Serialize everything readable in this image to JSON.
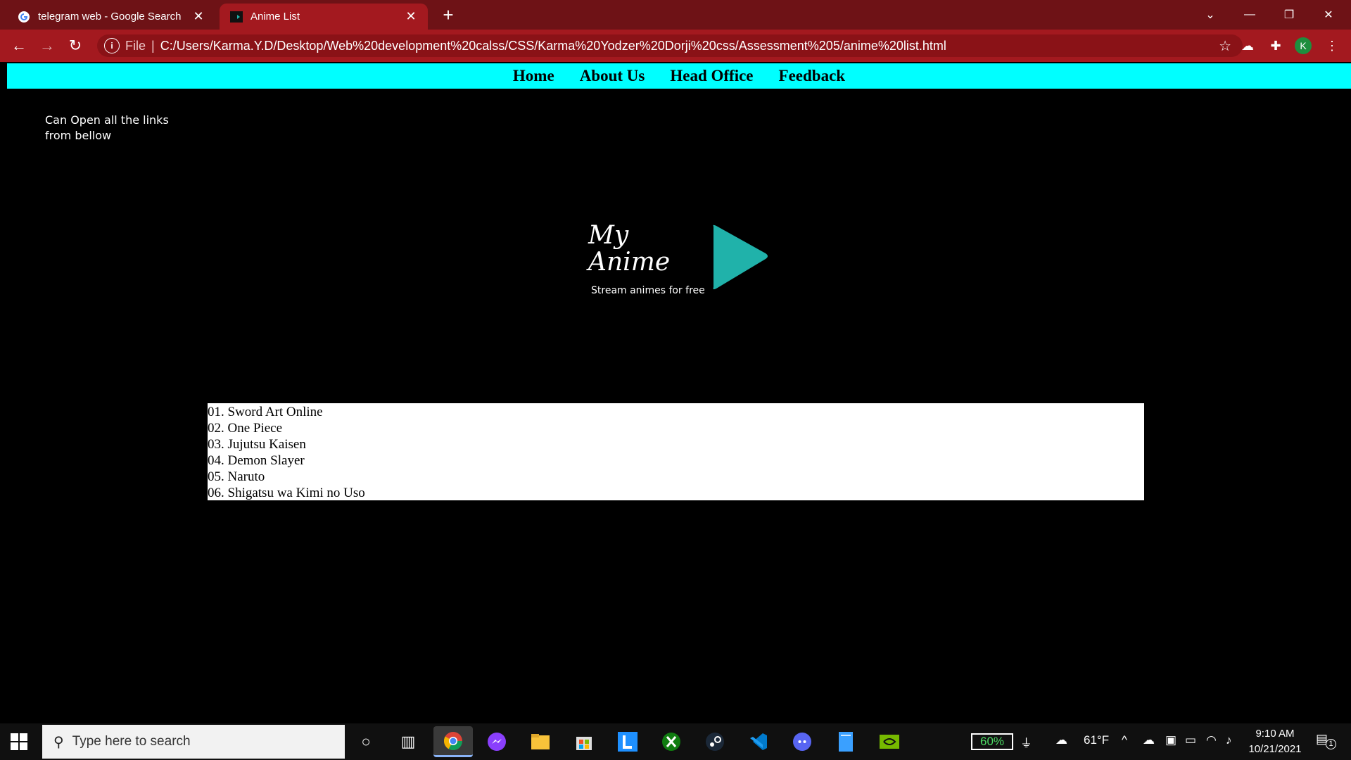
{
  "browser": {
    "tabs": [
      {
        "title": "telegram web - Google Search",
        "favicon": "google-g-icon",
        "active": false
      },
      {
        "title": "Anime List",
        "favicon": "page-icon",
        "active": true
      }
    ],
    "new_tab": "+",
    "address": {
      "scheme_label": "File",
      "url": "C:/Users/Karma.Y.D/Desktop/Web%20development%20calss/CSS/Karma%20Yodzer%20Dorji%20css/Assessment%205/anime%20list.html"
    },
    "profile_initial": "K"
  },
  "page": {
    "nav": [
      "Home",
      "About Us",
      "Head Office",
      "Feedback"
    ],
    "side_note": "Can Open all the links from bellow",
    "logo": {
      "line1": "My",
      "line2": "Anime",
      "tagline": "Stream animes for free",
      "play_color": "#20b2aa"
    },
    "anime_list": [
      "01. Sword Art Online",
      "02. One Piece",
      "03. Jujutsu Kaisen",
      "04. Demon Slayer",
      "05. Naruto",
      "06. Shigatsu wa Kimi no Uso"
    ]
  },
  "taskbar": {
    "search_placeholder": "Type here to search",
    "battery": "60%",
    "weather": "61°F",
    "time": "9:10 AM",
    "date": "10/21/2021",
    "notification_count": "1"
  },
  "colors": {
    "tabbar": "#6e1216",
    "toolbar": "#a3191f",
    "nav_bg": "#00ffff",
    "page_bg": "#000000"
  }
}
